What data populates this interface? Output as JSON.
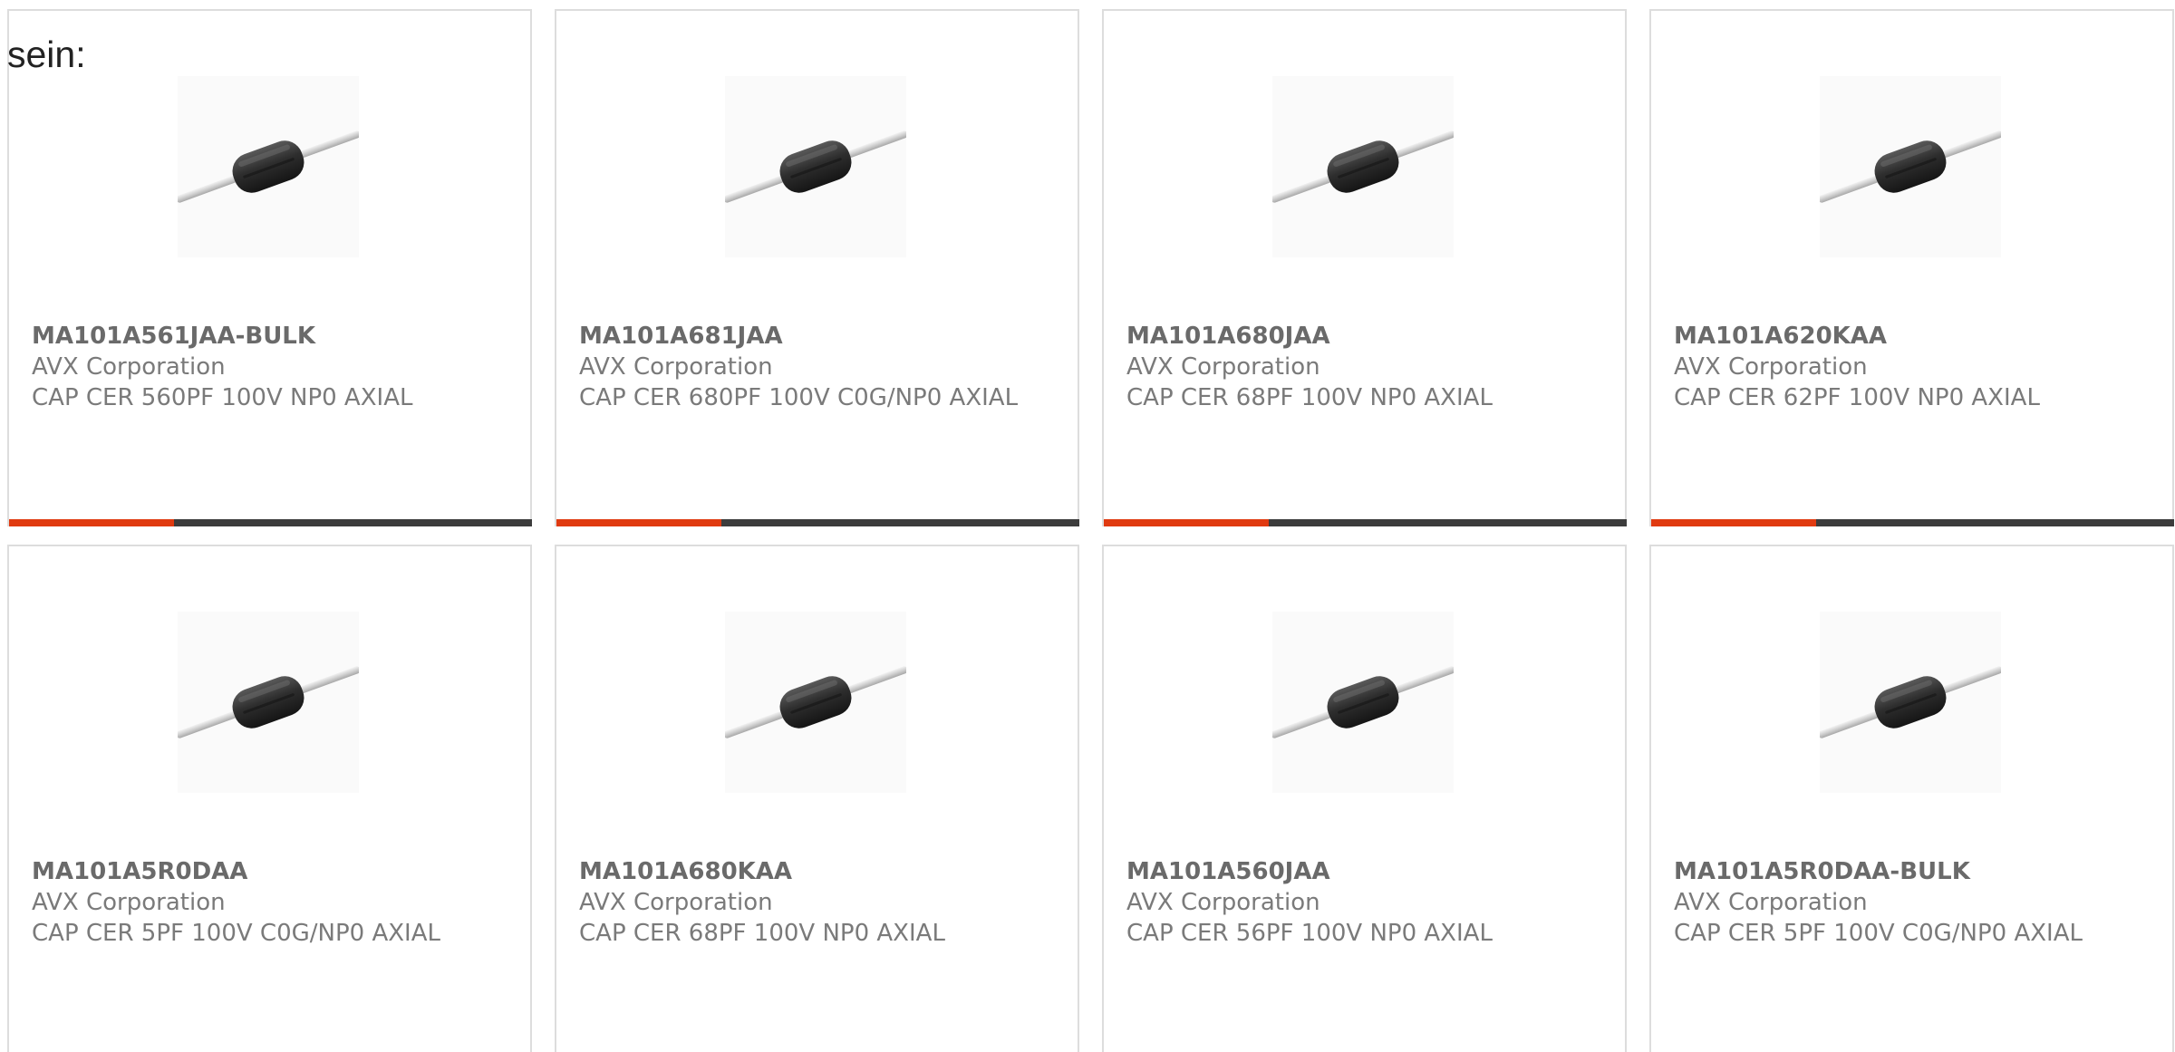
{
  "intro_text": "sein:",
  "colors": {
    "accent": "#e03a10",
    "bar": "#3c3c3c",
    "card_border": "#dddddd",
    "text": "#7a7a7a"
  },
  "products": [
    {
      "part": "MA101A561JAA-BULK",
      "manufacturer": "AVX Corporation",
      "description": "CAP CER 560PF 100V NP0 AXIAL",
      "image_icon": "axial-capacitor-icon"
    },
    {
      "part": "MA101A681JAA",
      "manufacturer": "AVX Corporation",
      "description": "CAP CER 680PF 100V C0G/NP0 AXIAL",
      "image_icon": "axial-capacitor-icon"
    },
    {
      "part": "MA101A680JAA",
      "manufacturer": "AVX Corporation",
      "description": "CAP CER 68PF 100V NP0 AXIAL",
      "image_icon": "axial-capacitor-icon"
    },
    {
      "part": "MA101A620KAA",
      "manufacturer": "AVX Corporation",
      "description": "CAP CER 62PF 100V NP0 AXIAL",
      "image_icon": "axial-capacitor-icon"
    },
    {
      "part": "MA101A5R0DAA",
      "manufacturer": "AVX Corporation",
      "description": "CAP CER 5PF 100V C0G/NP0 AXIAL",
      "image_icon": "axial-capacitor-icon"
    },
    {
      "part": "MA101A680KAA",
      "manufacturer": "AVX Corporation",
      "description": "CAP CER 68PF 100V NP0 AXIAL",
      "image_icon": "axial-capacitor-icon"
    },
    {
      "part": "MA101A560JAA",
      "manufacturer": "AVX Corporation",
      "description": "CAP CER 56PF 100V NP0 AXIAL",
      "image_icon": "axial-capacitor-icon"
    },
    {
      "part": "MA101A5R0DAA-BULK",
      "manufacturer": "AVX Corporation",
      "description": "CAP CER 5PF 100V C0G/NP0 AXIAL",
      "image_icon": "axial-capacitor-icon"
    }
  ]
}
